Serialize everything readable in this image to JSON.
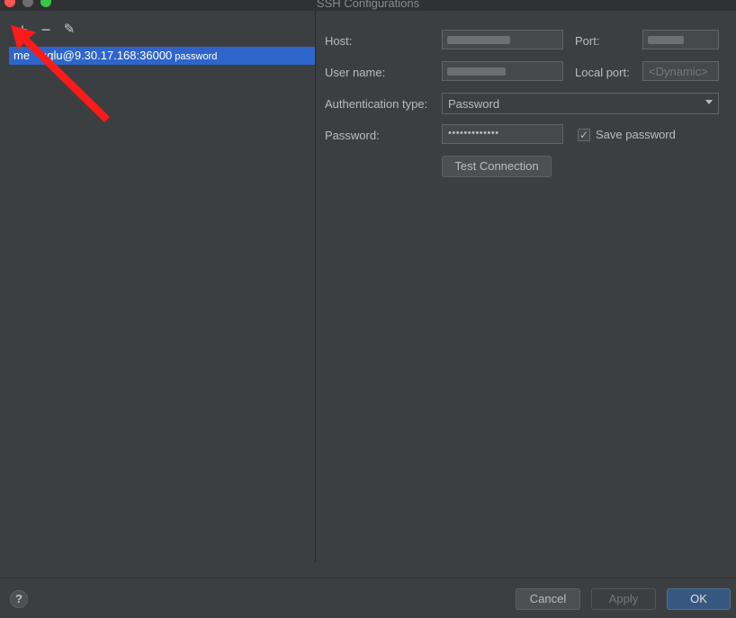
{
  "window": {
    "title": "SSH Configurations"
  },
  "toolbar": {
    "add": "+",
    "remove": "−",
    "edit": "✎"
  },
  "list": {
    "items": [
      {
        "name_prefix": "me",
        "name_rest": "nglu@9.30.17.168:36000",
        "auth_tag": "password"
      }
    ]
  },
  "form": {
    "host_label": "Host:",
    "host_value": "",
    "port_label": "Port:",
    "port_value": "",
    "username_label": "User name:",
    "username_value": "",
    "local_port_label": "Local port:",
    "local_port_placeholder": "<Dynamic>",
    "auth_type_label": "Authentication type:",
    "auth_type_value": "Password",
    "password_label": "Password:",
    "password_value": "•••••••••••••",
    "save_password_label": "Save password",
    "save_password_checked": "✓",
    "test_connection_label": "Test Connection"
  },
  "footer": {
    "help": "?",
    "cancel": "Cancel",
    "apply": "Apply",
    "ok": "OK"
  },
  "colors": {
    "background": "#3c3f41",
    "selection": "#2f65ca",
    "primary_button": "#365880",
    "annotation_arrow": "#ff0000"
  },
  "icons": [
    "add-icon",
    "remove-icon",
    "edit-icon",
    "dropdown-caret-icon",
    "checkmark-icon",
    "help-icon",
    "red-arrow-icon"
  ]
}
